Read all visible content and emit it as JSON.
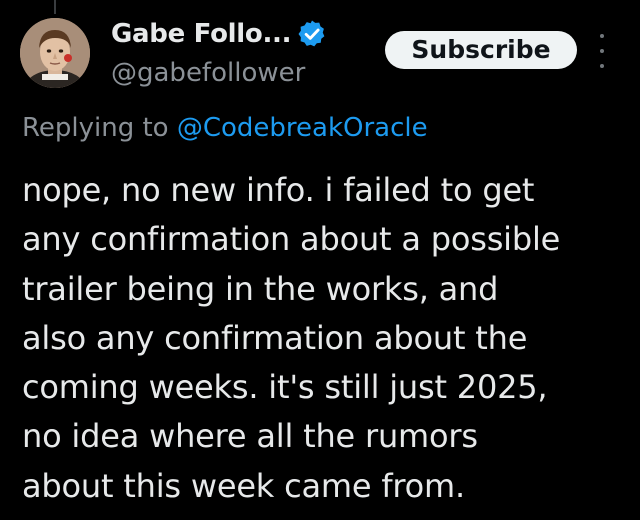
{
  "author": {
    "display_name": "Gabe Follo...",
    "handle": "@gabefollower",
    "verified_icon": "verified-badge-icon",
    "avatar_icon": "profile-avatar"
  },
  "actions": {
    "subscribe_label": "Subscribe",
    "more_icon": "more-options-icon"
  },
  "reply_context": {
    "prefix": "Replying to",
    "mention": "@CodebreakOracle"
  },
  "tweet": {
    "lines": [
      "nope, no new info. i failed to get",
      "any confirmation about a possible",
      "trailer being in the works, and",
      "also any confirmation about the",
      "coming weeks. it's still just 2025,",
      "no idea where all the rumors",
      "about this week came from."
    ]
  },
  "colors": {
    "background": "#000000",
    "text": "#e7e9ea",
    "secondary_text": "#8b9197",
    "link": "#1d9bf0",
    "verified": "#1d9bf0",
    "button_bg": "#eff3f4",
    "button_text": "#0f1419"
  }
}
